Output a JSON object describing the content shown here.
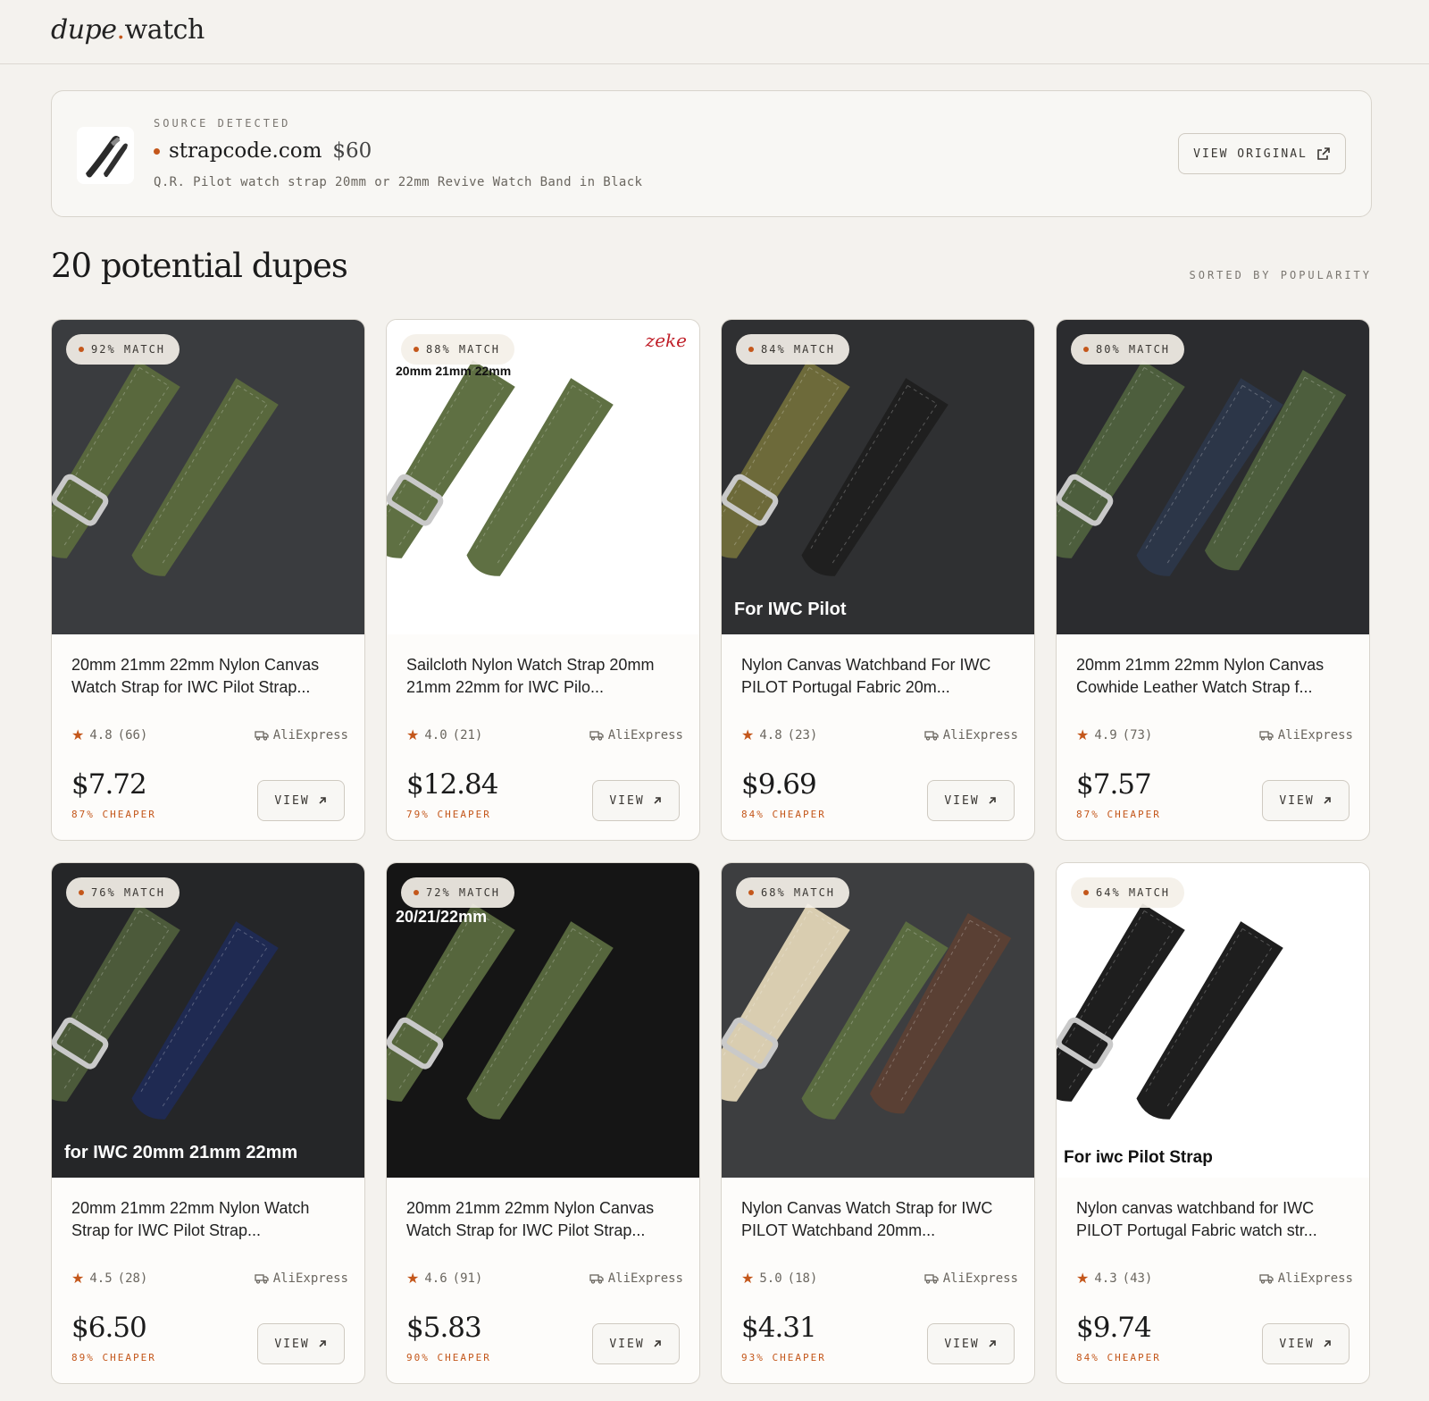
{
  "header": {
    "logo_a": "dupe",
    "logo_dot": ".",
    "logo_b": "watch"
  },
  "source": {
    "label": "SOURCE DETECTED",
    "domain": "strapcode.com",
    "price": "$60",
    "description": "Q.R. Pilot watch strap 20mm or 22mm Revive Watch Band in Black",
    "button": "VIEW ORIGINAL"
  },
  "results": {
    "heading": "20 potential dupes",
    "sort": "SORTED BY POPULARITY"
  },
  "colors": {
    "accent": "#c4571b",
    "background": "#f4f2ee",
    "card": "#fdfcfa",
    "border": "#d8d4cc"
  },
  "cards": [
    {
      "match": "92% MATCH",
      "title": "20mm 21mm 22mm Nylon Canvas Watch Strap for IWC Pilot Strap...",
      "rating": "4.8",
      "reviews": "(66)",
      "store": "AliExpress",
      "price": "$7.72",
      "savings": "87% CHEAPER",
      "button": "VIEW",
      "photo": {
        "bg": "#3a3c3f",
        "strap": "#59683d",
        "caption": ""
      }
    },
    {
      "match": "88% MATCH",
      "title": "Sailcloth Nylon Watch Strap 20mm 21mm 22mm for IWC Pilo...",
      "rating": "4.0",
      "reviews": "(21)",
      "store": "AliExpress",
      "price": "$12.84",
      "savings": "79% CHEAPER",
      "button": "VIEW",
      "photo": {
        "bg": "#ffffff",
        "strap": "#5f7043",
        "caption": "20mm 21mm 22mm",
        "brand": "zeke"
      }
    },
    {
      "match": "84% MATCH",
      "title": "Nylon Canvas Watchband For IWC PILOT Portugal Fabric 20m...",
      "rating": "4.8",
      "reviews": "(23)",
      "store": "AliExpress",
      "price": "$9.69",
      "savings": "84% CHEAPER",
      "button": "VIEW",
      "photo": {
        "bg": "#2f3032",
        "strap": "#6d6a3a",
        "caption": "For IWC Pilot"
      }
    },
    {
      "match": "80% MATCH",
      "title": "20mm 21mm 22mm Nylon Canvas Cowhide Leather Watch Strap f...",
      "rating": "4.9",
      "reviews": "(73)",
      "store": "AliExpress",
      "price": "$7.57",
      "savings": "87% CHEAPER",
      "button": "VIEW",
      "photo": {
        "bg": "#2b2c2f",
        "strap": "#4d5e3d",
        "caption": ""
      }
    },
    {
      "match": "76% MATCH",
      "title": "20mm 21mm 22mm Nylon Watch Strap for IWC Pilot Strap...",
      "rating": "4.5",
      "reviews": "(28)",
      "store": "AliExpress",
      "price": "$6.50",
      "savings": "89% CHEAPER",
      "button": "VIEW",
      "photo": {
        "bg": "#252628",
        "strap": "#4c5a3a",
        "caption": "for IWC 20mm 21mm 22mm"
      }
    },
    {
      "match": "72% MATCH",
      "title": "20mm 21mm 22mm Nylon Canvas Watch Strap for IWC Pilot Strap...",
      "rating": "4.6",
      "reviews": "(91)",
      "store": "AliExpress",
      "price": "$5.83",
      "savings": "90% CHEAPER",
      "button": "VIEW",
      "photo": {
        "bg": "#151515",
        "strap": "#56663d",
        "caption": "20/21/22mm"
      }
    },
    {
      "match": "68% MATCH",
      "title": "Nylon Canvas Watch Strap for IWC PILOT Watchband 20mm...",
      "rating": "5.0",
      "reviews": "(18)",
      "store": "AliExpress",
      "price": "$4.31",
      "savings": "93% CHEAPER",
      "button": "VIEW",
      "photo": {
        "bg": "#3d3e40",
        "strap": "#5a6b40",
        "caption": ""
      }
    },
    {
      "match": "64% MATCH",
      "title": "Nylon canvas watchband for IWC PILOT Portugal Fabric watch str...",
      "rating": "4.3",
      "reviews": "(43)",
      "store": "AliExpress",
      "price": "$9.74",
      "savings": "84% CHEAPER",
      "button": "VIEW",
      "photo": {
        "bg": "#ffffff",
        "strap": "#1e1e1e",
        "caption": "For iwc Pilot Strap"
      }
    }
  ]
}
